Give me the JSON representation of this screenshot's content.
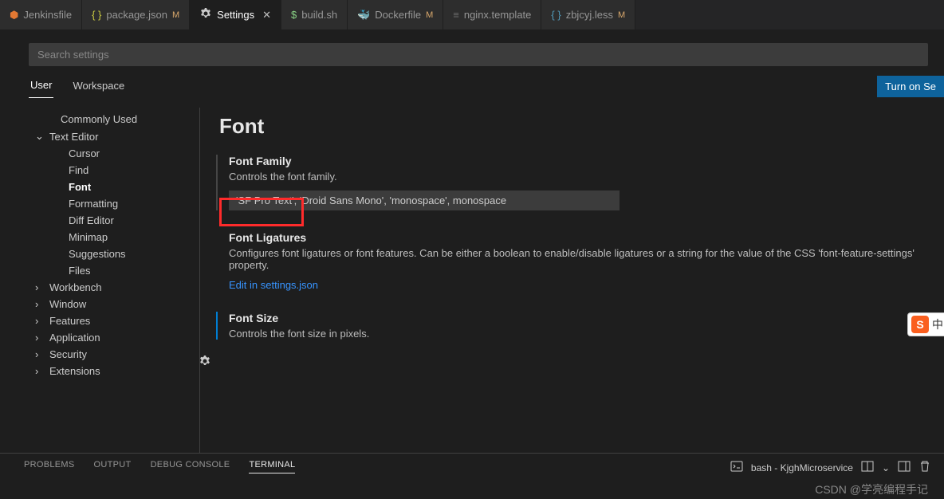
{
  "tabs": [
    {
      "icon": "red",
      "label": "Jenkinsfile",
      "mod": ""
    },
    {
      "icon": "json",
      "label": "package.json",
      "mod": "M"
    },
    {
      "icon": "gear",
      "label": "Settings",
      "mod": "",
      "active": true,
      "close": true
    },
    {
      "icon": "dollar",
      "label": "build.sh",
      "mod": ""
    },
    {
      "icon": "docker",
      "label": "Dockerfile",
      "mod": "M"
    },
    {
      "icon": "conf",
      "label": "nginx.template",
      "mod": ""
    },
    {
      "icon": "less",
      "label": "zbjcyj.less",
      "mod": "M"
    }
  ],
  "search": {
    "placeholder": "Search settings"
  },
  "scope": {
    "user": "User",
    "workspace": "Workspace",
    "sync": "Turn on Se"
  },
  "tree": {
    "items": [
      {
        "label": "Commonly Used",
        "indent": 1
      },
      {
        "label": "Text Editor",
        "indent": 0,
        "chev": "down"
      },
      {
        "label": "Cursor",
        "indent": 2
      },
      {
        "label": "Find",
        "indent": 2
      },
      {
        "label": "Font",
        "indent": 2,
        "sel": true
      },
      {
        "label": "Formatting",
        "indent": 2
      },
      {
        "label": "Diff Editor",
        "indent": 2
      },
      {
        "label": "Minimap",
        "indent": 2
      },
      {
        "label": "Suggestions",
        "indent": 2
      },
      {
        "label": "Files",
        "indent": 2
      },
      {
        "label": "Workbench",
        "indent": 0,
        "chev": "right"
      },
      {
        "label": "Window",
        "indent": 0,
        "chev": "right"
      },
      {
        "label": "Features",
        "indent": 0,
        "chev": "right"
      },
      {
        "label": "Application",
        "indent": 0,
        "chev": "right"
      },
      {
        "label": "Security",
        "indent": 0,
        "chev": "right"
      },
      {
        "label": "Extensions",
        "indent": 0,
        "chev": "right"
      }
    ]
  },
  "content": {
    "heading": "Font",
    "fontFamily": {
      "title": "Font Family",
      "desc": "Controls the font family.",
      "value": "'SF Pro Text', 'Droid Sans Mono', 'monospace', monospace"
    },
    "fontLigatures": {
      "title": "Font Ligatures",
      "desc": "Configures font ligatures or font features. Can be either a boolean to enable/disable ligatures or a string for the value of the CSS 'font-feature-settings' property.",
      "link": "Edit in settings.json"
    },
    "fontSize": {
      "title": "Font Size",
      "desc": "Controls the font size in pixels."
    }
  },
  "panel": {
    "tabs": [
      "PROBLEMS",
      "OUTPUT",
      "DEBUG CONSOLE",
      "TERMINAL"
    ],
    "active": 3,
    "term": "bash - KjghMicroservice"
  },
  "watermark": "CSDN @学亮编程手记",
  "ime": {
    "badge": "S",
    "text": "中"
  }
}
